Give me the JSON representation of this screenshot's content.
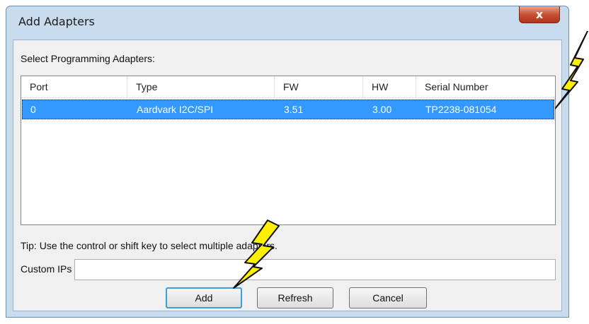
{
  "window": {
    "title": "Add Adapters",
    "close_symbol": "x"
  },
  "dialog": {
    "select_label": "Select Programming Adapters:",
    "columns": [
      "Port",
      "Type",
      "FW",
      "HW",
      "Serial Number"
    ],
    "rows": [
      {
        "port": "0",
        "type": "Aardvark I2C/SPI",
        "fw": "3.51",
        "hw": "3.00",
        "serial": "TP2238-081054",
        "selected": true
      }
    ],
    "tip": "Tip: Use the control or shift key to select multiple adapters.",
    "custom_ips_label": "Custom IPs",
    "custom_ips_value": ""
  },
  "buttons": {
    "add": "Add",
    "refresh": "Refresh",
    "cancel": "Cancel"
  },
  "colors": {
    "selection": "#3399ff",
    "bolt_fill": "#ffef00",
    "default_button_border": "#3b9fd9"
  },
  "icons": {
    "annotations": [
      "lightning-bolt-icon",
      "lightning-bolt-icon"
    ]
  }
}
